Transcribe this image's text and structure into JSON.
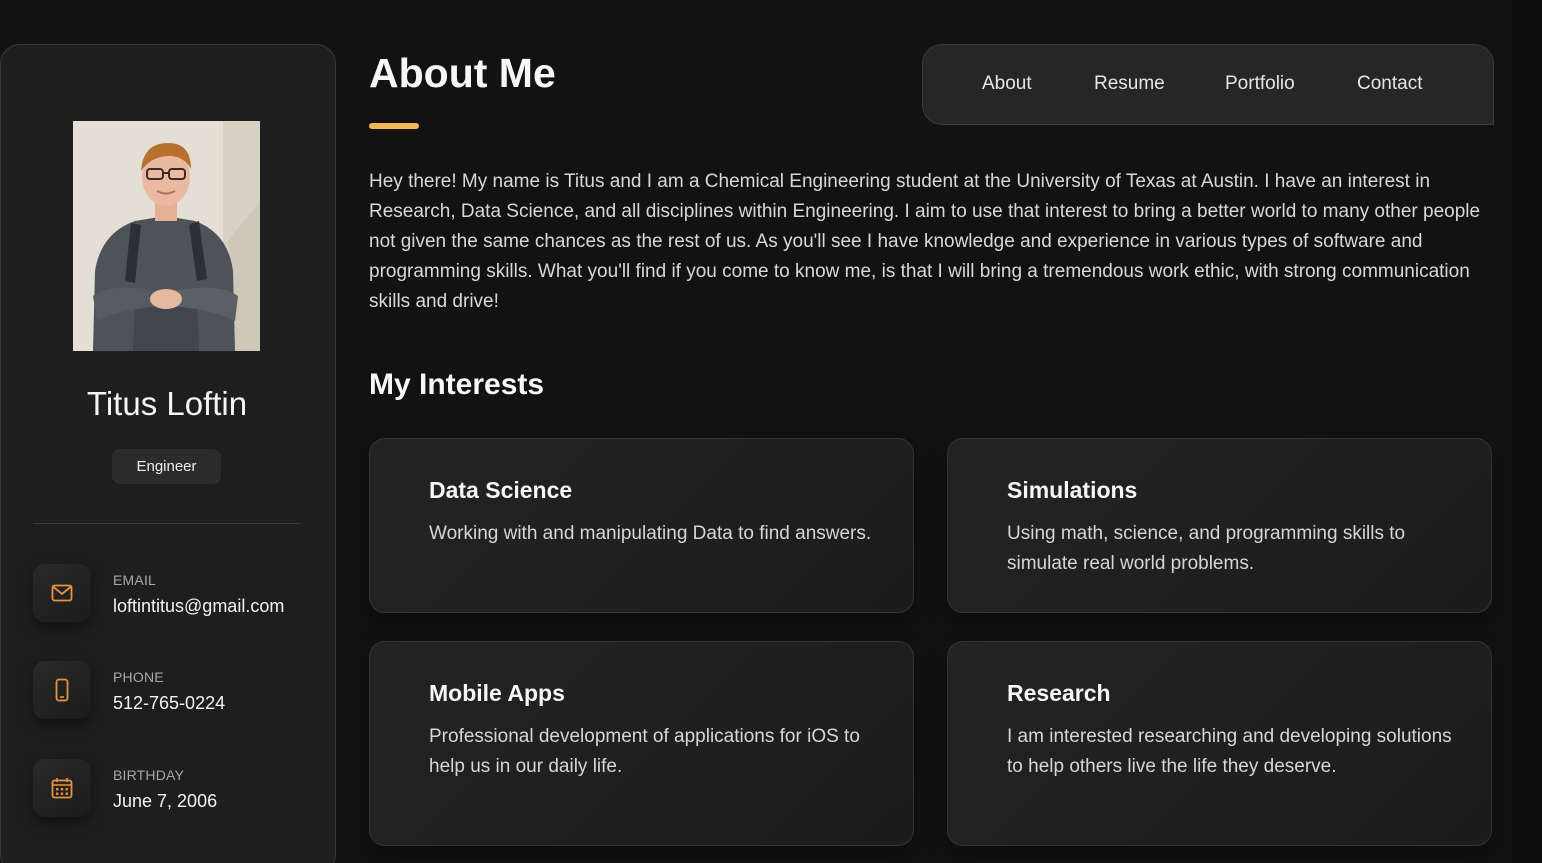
{
  "sidebar": {
    "name": "Titus Loftin",
    "title": "Engineer",
    "contacts": [
      {
        "label": "EMAIL",
        "value": "loftintitus@gmail.com",
        "icon": "mail-icon"
      },
      {
        "label": "PHONE",
        "value": "512-765-0224",
        "icon": "phone-icon"
      },
      {
        "label": "BIRTHDAY",
        "value": "June 7, 2006",
        "icon": "calendar-icon"
      }
    ]
  },
  "nav": {
    "items": [
      "About",
      "Resume",
      "Portfolio",
      "Contact"
    ]
  },
  "about": {
    "title": "About Me",
    "text": "Hey there! My name is Titus and I am a Chemical Engineering student at the University of Texas at Austin. I have an interest in Research, Data Science, and all disciplines within Engineering. I aim to use that interest to bring a better world to many other people not given the same chances as the rest of us. As you'll see I have knowledge and experience in various types of software and programming skills. What you'll find if you come to know me, is that I will bring a tremendous work ethic, with strong communication skills and drive!"
  },
  "interests": {
    "title": "My Interests",
    "items": [
      {
        "title": "Data Science",
        "text": "Working with and manipulating Data to find answers."
      },
      {
        "title": "Simulations",
        "text": "Using math, science, and programming skills to simulate real world problems."
      },
      {
        "title": "Mobile Apps",
        "text": "Professional development of applications for iOS to help us in our daily life."
      },
      {
        "title": "Research",
        "text": "I am interested researching and developing solutions to help others live the life they deserve."
      }
    ]
  },
  "colors": {
    "accent": "#f3b65b",
    "icon": "#e9923a",
    "background": "#121212",
    "panel": "#1e1e1f"
  }
}
